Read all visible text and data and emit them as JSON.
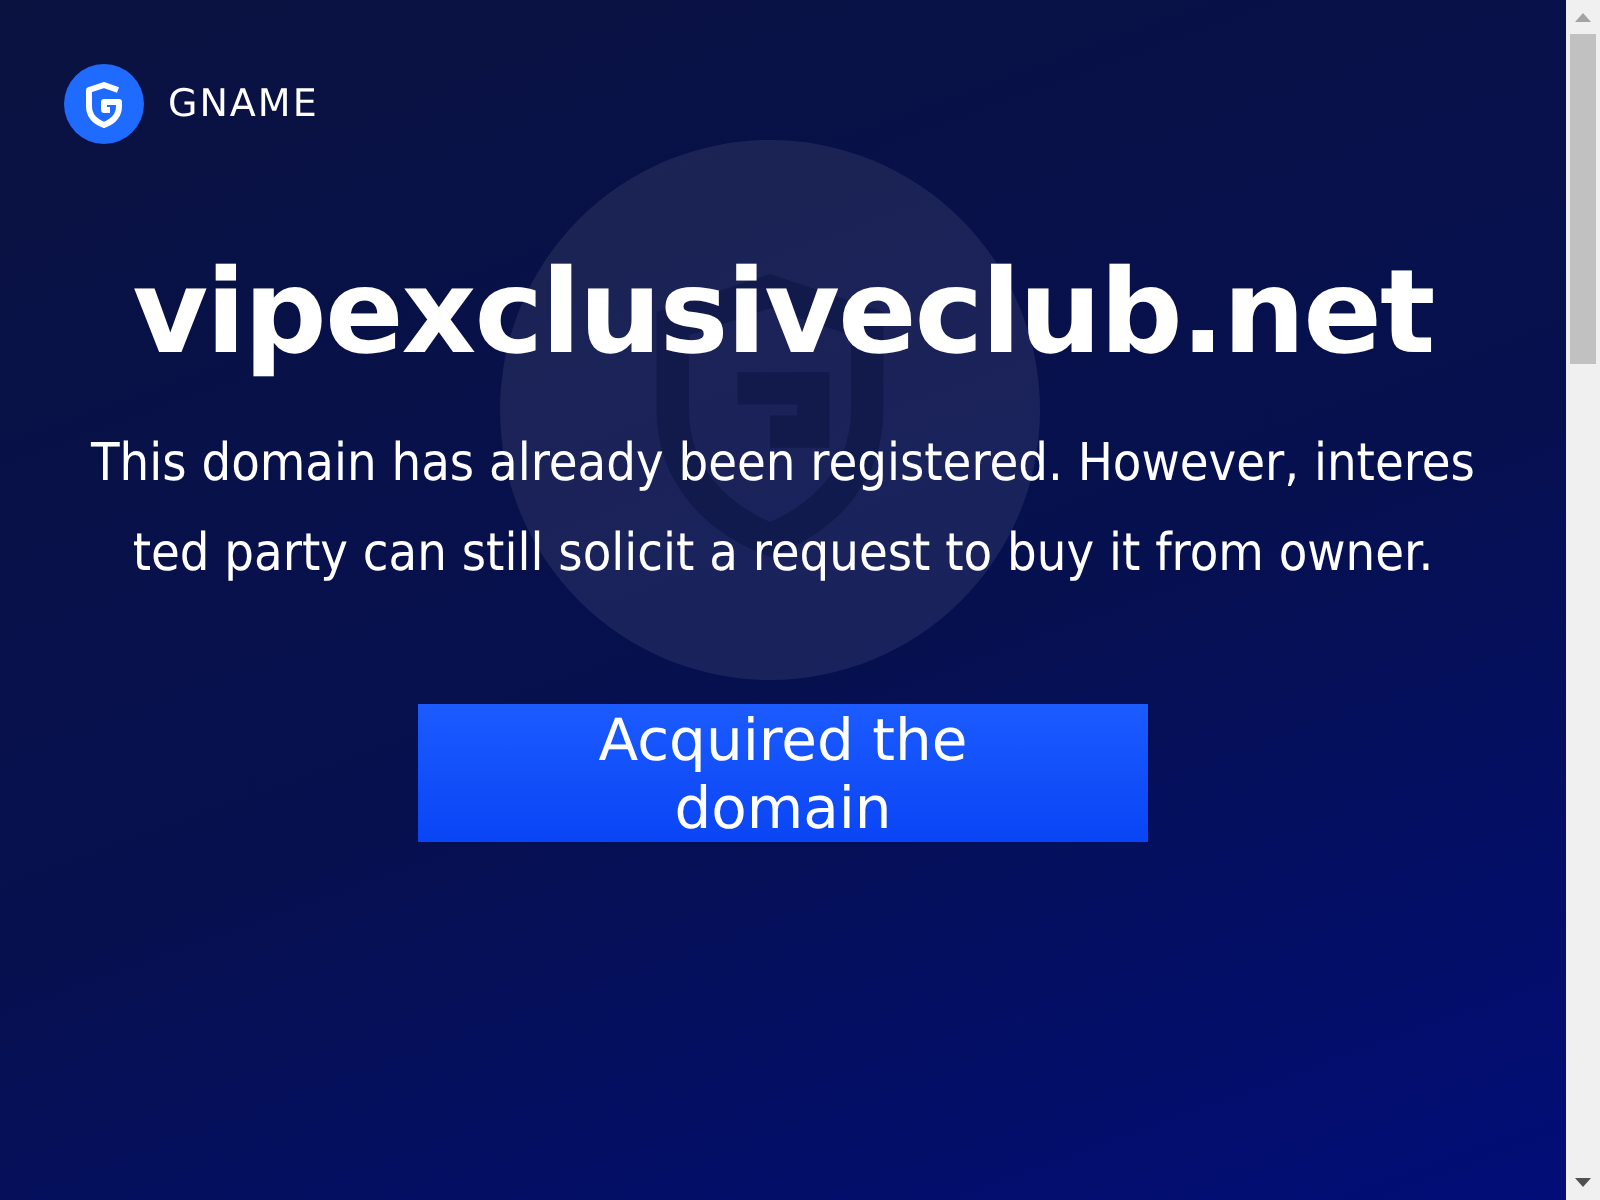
{
  "header": {
    "brand": "GNAME"
  },
  "domain": "vipexclusiveclub.net",
  "message": "This domain has already been registered. However, interested party can still solicit a request to buy it from owner.",
  "button": {
    "label": "Acquired the domain"
  }
}
